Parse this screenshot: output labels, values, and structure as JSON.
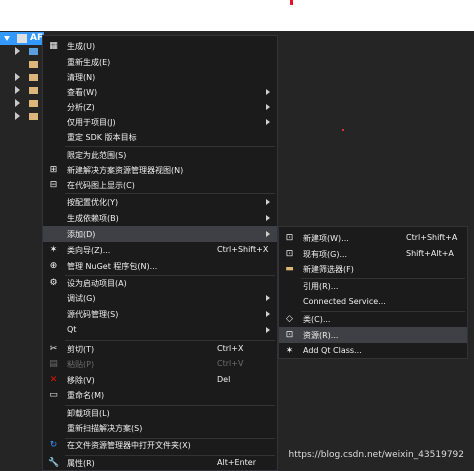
{
  "project": {
    "name": "AF"
  },
  "context_menu": {
    "items": [
      {
        "label": "生成(U)"
      },
      {
        "label": "重新生成(E)"
      },
      {
        "label": "清理(N)"
      },
      {
        "label": "查看(W)"
      },
      {
        "label": "分析(Z)"
      },
      {
        "label": "仅用于项目(J)"
      },
      {
        "label": "重定 SDK 版本目标"
      },
      {
        "label": "限定为此范围(S)"
      },
      {
        "label": "新建解决方案资源管理器视图(N)"
      },
      {
        "label": "在代码图上显示(C)"
      },
      {
        "label": "按配置优化(Y)"
      },
      {
        "label": "生成依赖项(B)"
      },
      {
        "label": "添加(D)"
      },
      {
        "label": "类向导(Z)...",
        "shortcut": "Ctrl+Shift+X"
      },
      {
        "label": "管理 NuGet 程序包(N)..."
      },
      {
        "label": "设为启动项目(A)"
      },
      {
        "label": "调试(G)"
      },
      {
        "label": "源代码管理(S)"
      },
      {
        "label": "Qt"
      },
      {
        "label": "剪切(T)",
        "shortcut": "Ctrl+X"
      },
      {
        "label": "粘贴(P)",
        "shortcut": "Ctrl+V"
      },
      {
        "label": "移除(V)",
        "shortcut": "Del"
      },
      {
        "label": "重命名(M)"
      },
      {
        "label": "卸载项目(L)"
      },
      {
        "label": "重新扫描解决方案(S)"
      },
      {
        "label": "在文件资源管理器中打开文件夹(X)"
      },
      {
        "label": "属性(R)",
        "shortcut": "Alt+Enter"
      }
    ]
  },
  "submenu": {
    "items": [
      {
        "label": "新建项(W)...",
        "shortcut": "Ctrl+Shift+A"
      },
      {
        "label": "现有项(G)...",
        "shortcut": "Shift+Alt+A"
      },
      {
        "label": "新建筛选器(F)"
      },
      {
        "label": "引用(R)..."
      },
      {
        "label": "Connected Service..."
      },
      {
        "label": "类(C)..."
      },
      {
        "label": "资源(R)..."
      },
      {
        "label": "Add Qt Class..."
      }
    ]
  },
  "watermark": "https://blog.csdn.net/weixin_43519792",
  "colors": {
    "background": "#1b1b1c",
    "highlight": "#3f3f46",
    "selection": "#3399ff",
    "remove_icon": "#e51400"
  }
}
